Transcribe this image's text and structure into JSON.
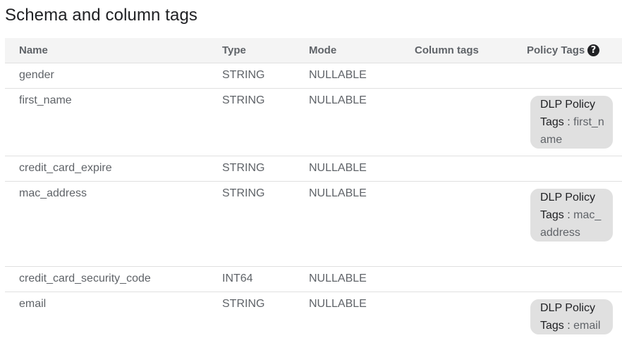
{
  "page": {
    "title": "Schema and column tags"
  },
  "table": {
    "columns": {
      "name": "Name",
      "type": "Type",
      "mode": "Mode",
      "column_tags": "Column tags",
      "policy_tags": "Policy Tags"
    },
    "help_icon": "?",
    "rows": [
      {
        "name": "gender",
        "type": "STRING",
        "mode": "NULLABLE"
      },
      {
        "name": "first_name",
        "type": "STRING",
        "mode": "NULLABLE",
        "policy_tag": {
          "label": "DLP Policy Tags",
          "separator": ":",
          "value": "first_name"
        }
      },
      {
        "name": "credit_card_expire",
        "type": "STRING",
        "mode": "NULLABLE"
      },
      {
        "name": "mac_address",
        "type": "STRING",
        "mode": "NULLABLE",
        "policy_tag": {
          "label": "DLP Policy Tags",
          "separator": ":",
          "value": "mac_address"
        }
      },
      {
        "name": "credit_card_security_code",
        "type": "INT64",
        "mode": "NULLABLE"
      },
      {
        "name": "email",
        "type": "STRING",
        "mode": "NULLABLE",
        "policy_tag": {
          "label": "DLP Policy Tags",
          "separator": ":",
          "value": "email"
        }
      }
    ]
  },
  "icons": {
    "help": "help-circle-icon"
  }
}
